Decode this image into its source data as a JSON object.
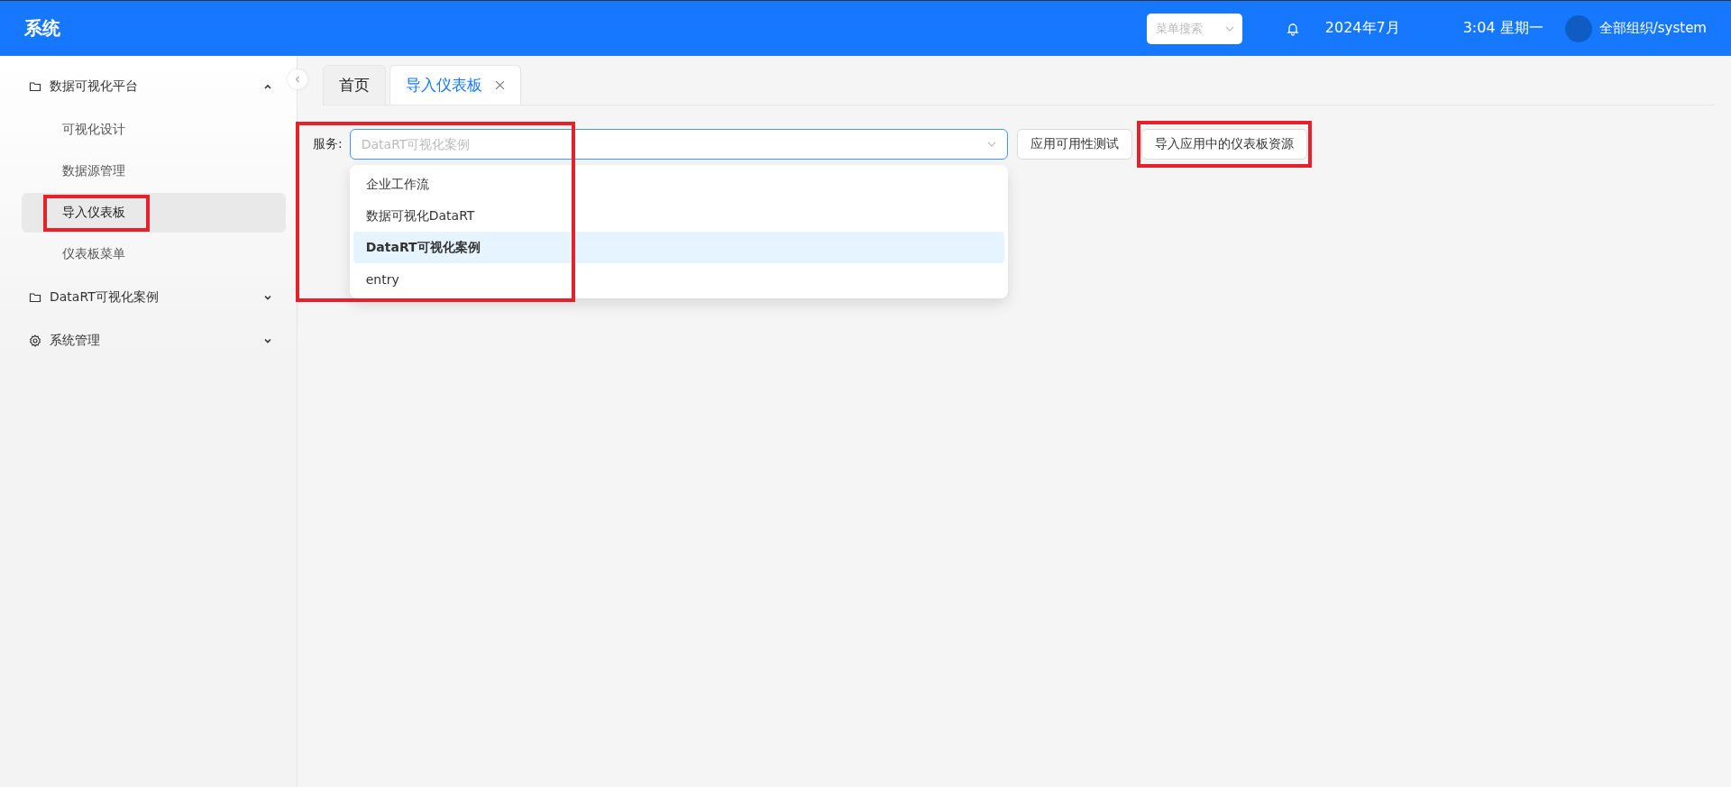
{
  "header": {
    "title": "系统",
    "menu_search": {
      "placeholder": "菜单搜索"
    },
    "date": "2024年7月",
    "time": "3:04 星期一",
    "user": "全部组织/system"
  },
  "sidebar": {
    "items": [
      {
        "label": "数据可视化平台",
        "kind": "folder",
        "expanded": true,
        "children": [
          {
            "label": "可视化设计",
            "selected": false
          },
          {
            "label": "数据源管理",
            "selected": false
          },
          {
            "label": "导入仪表板",
            "selected": true
          },
          {
            "label": "仪表板菜单",
            "selected": false
          }
        ]
      },
      {
        "label": "DataRT可视化案例",
        "kind": "folder",
        "expanded": false
      },
      {
        "label": "系统管理",
        "kind": "settings",
        "expanded": false
      }
    ]
  },
  "tabs": [
    {
      "label": "首页",
      "selected": false,
      "closable": false
    },
    {
      "label": "导入仪表板",
      "selected": true,
      "closable": true
    }
  ],
  "service": {
    "label": "服务:",
    "placeholder": "DataRT可视化案例",
    "open": true,
    "options": [
      {
        "label": "企业工作流",
        "selected": false
      },
      {
        "label": "数据可视化DataRT",
        "selected": false
      },
      {
        "label": "DataRT可视化案例",
        "selected": true
      },
      {
        "label": "entry",
        "selected": false
      }
    ]
  },
  "buttons": [
    "应用可用性测试",
    "导入应用中的仪表板资源"
  ]
}
